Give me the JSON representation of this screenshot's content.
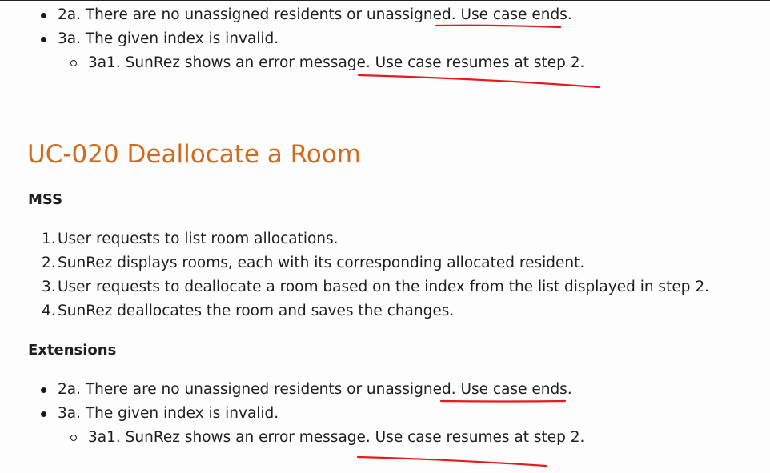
{
  "top_extensions": [
    {
      "text": "2a. There are no unassigned residents or unassigned. Use case ends."
    },
    {
      "text": "3a. The given index is invalid."
    }
  ],
  "top_sub_extension": "3a1. SunRez shows an error message. Use case resumes at step 2.",
  "heading": "UC-020 Deallocate a Room",
  "mss_heading": "MSS",
  "mss_steps": [
    {
      "num": "1.",
      "text": "User requests to list room allocations."
    },
    {
      "num": "2.",
      "text": "SunRez displays rooms, each with its corresponding allocated resident."
    },
    {
      "num": "3.",
      "text": "User requests to deallocate a room based on the index from the list displayed in step 2."
    },
    {
      "num": "4.",
      "text": "SunRez deallocates the room and saves the changes."
    }
  ],
  "extensions_heading": "Extensions",
  "extensions": [
    {
      "text": "2a. There are no unassigned residents or unassigned. Use case ends."
    },
    {
      "text": "3a. The given index is invalid."
    }
  ],
  "sub_extension": "3a1. SunRez shows an error message. Use case resumes at step 2.",
  "colors": {
    "heading": "#d2691e",
    "annotation": "#e8191e"
  }
}
